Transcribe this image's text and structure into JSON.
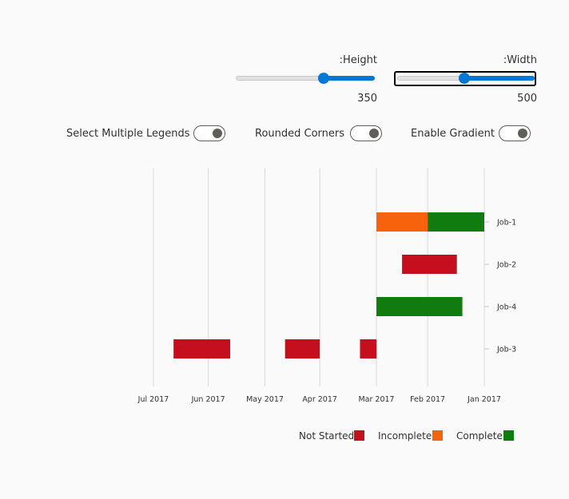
{
  "controls": {
    "height": {
      "label": ":Height",
      "value": "350",
      "fraction": 0.63
    },
    "width": {
      "label": ":Width",
      "value": "500",
      "fraction": 0.49
    },
    "toggles": [
      {
        "label": "Select Multiple Legends",
        "on": false
      },
      {
        "label": "Rounded Corners",
        "on": false
      },
      {
        "label": "Enable Gradient",
        "on": false
      }
    ]
  },
  "chart_data": {
    "type": "gantt",
    "orientation": "right-to-left",
    "x_ticks": [
      "Jul 2017",
      "Jun 2017",
      "May 2017",
      "Apr 2017",
      "Mar 2017",
      "Feb 2017",
      "Jan 2017"
    ],
    "x_range": [
      "2017-01-01",
      "2017-07-01"
    ],
    "categories": [
      "Job-1",
      "Job-2",
      "Job-4",
      "Job-3"
    ],
    "series": [
      {
        "name": "Not Started",
        "color": "#c50f1f"
      },
      {
        "name": "Incomplete",
        "color": "#f7630c"
      },
      {
        "name": "Complete",
        "color": "#107c10"
      }
    ],
    "tasks": [
      {
        "job": "Job-1",
        "status": "Complete",
        "start": "2017-01-01",
        "end": "2017-02-01"
      },
      {
        "job": "Job-1",
        "status": "Incomplete",
        "start": "2017-02-01",
        "end": "2017-03-01"
      },
      {
        "job": "Job-2",
        "status": "Not Started",
        "start": "2017-01-16",
        "end": "2017-02-15"
      },
      {
        "job": "Job-4",
        "status": "Complete",
        "start": "2017-01-13",
        "end": "2017-03-01"
      },
      {
        "job": "Job-3",
        "status": "Not Started",
        "start": "2017-03-01",
        "end": "2017-03-10"
      },
      {
        "job": "Job-3",
        "status": "Not Started",
        "start": "2017-04-01",
        "end": "2017-04-20"
      },
      {
        "job": "Job-3",
        "status": "Not Started",
        "start": "2017-05-20",
        "end": "2017-06-20"
      }
    ],
    "grid": true,
    "legend_position": "bottom-right"
  }
}
